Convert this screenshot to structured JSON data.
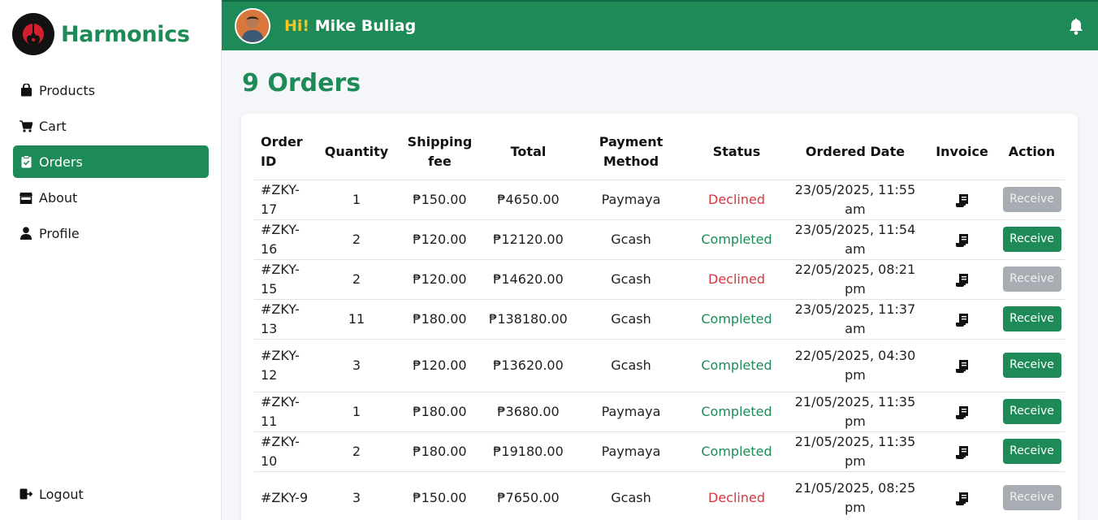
{
  "app": {
    "name": "Harmonics"
  },
  "nav": {
    "items": [
      {
        "label": "Products",
        "icon": "shopping-bag-icon",
        "active": false
      },
      {
        "label": "Cart",
        "icon": "cart-icon",
        "active": false
      },
      {
        "label": "Orders",
        "icon": "clipboard-check-icon",
        "active": true
      },
      {
        "label": "About",
        "icon": "store-icon",
        "active": false
      },
      {
        "label": "Profile",
        "icon": "user-icon",
        "active": false
      }
    ],
    "logout": "Logout"
  },
  "header": {
    "hi": "Hi!",
    "user_name": "Mike Buliag"
  },
  "page": {
    "title": "9 Orders"
  },
  "table": {
    "headers": {
      "order_id_1": "Order",
      "order_id_2": "ID",
      "quantity": "Quantity",
      "shipping_1": "Shipping",
      "shipping_2": "fee",
      "total": "Total",
      "payment_1": "Payment",
      "payment_2": "Method",
      "status": "Status",
      "date": "Ordered Date",
      "invoice": "Invoice",
      "action": "Action"
    },
    "rows": [
      {
        "id": "#ZKY-17",
        "qty": "1",
        "ship": "₱150.00",
        "total": "₱4650.00",
        "method": "Paymaya",
        "status": "Declined",
        "date": "23/05/2025, 11:55 am",
        "action": "Receive"
      },
      {
        "id": "#ZKY-16",
        "qty": "2",
        "ship": "₱120.00",
        "total": "₱12120.00",
        "method": "Gcash",
        "status": "Completed",
        "date": "23/05/2025, 11:54 am",
        "action": "Receive"
      },
      {
        "id": "#ZKY-15",
        "qty": "2",
        "ship": "₱120.00",
        "total": "₱14620.00",
        "method": "Gcash",
        "status": "Declined",
        "date": "22/05/2025, 08:21 pm",
        "action": "Receive"
      },
      {
        "id": "#ZKY-13",
        "qty": "11",
        "ship": "₱180.00",
        "total": "₱138180.00",
        "method": "Gcash",
        "status": "Completed",
        "date": "23/05/2025, 11:37 am",
        "action": "Receive"
      },
      {
        "id": "#ZKY-12",
        "qty": "3",
        "ship": "₱120.00",
        "total": "₱13620.00",
        "method": "Gcash",
        "status": "Completed",
        "date": "22/05/2025, 04:30 pm",
        "action": "Receive"
      },
      {
        "id": "#ZKY-11",
        "qty": "1",
        "ship": "₱180.00",
        "total": "₱3680.00",
        "method": "Paymaya",
        "status": "Completed",
        "date": "21/05/2025, 11:35 pm",
        "action": "Receive"
      },
      {
        "id": "#ZKY-10",
        "qty": "2",
        "ship": "₱180.00",
        "total": "₱19180.00",
        "method": "Paymaya",
        "status": "Completed",
        "date": "21/05/2025, 11:35 pm",
        "action": "Receive"
      },
      {
        "id": "#ZKY-9",
        "qty": "3",
        "ship": "₱150.00",
        "total": "₱7650.00",
        "method": "Gcash",
        "status": "Declined",
        "date": "21/05/2025, 08:25 pm",
        "action": "Receive"
      }
    ]
  },
  "colors": {
    "brand": "#1e8a57",
    "declined": "#d9363e",
    "hi": "#f3c623",
    "disabled_button": "#a8adb3"
  }
}
